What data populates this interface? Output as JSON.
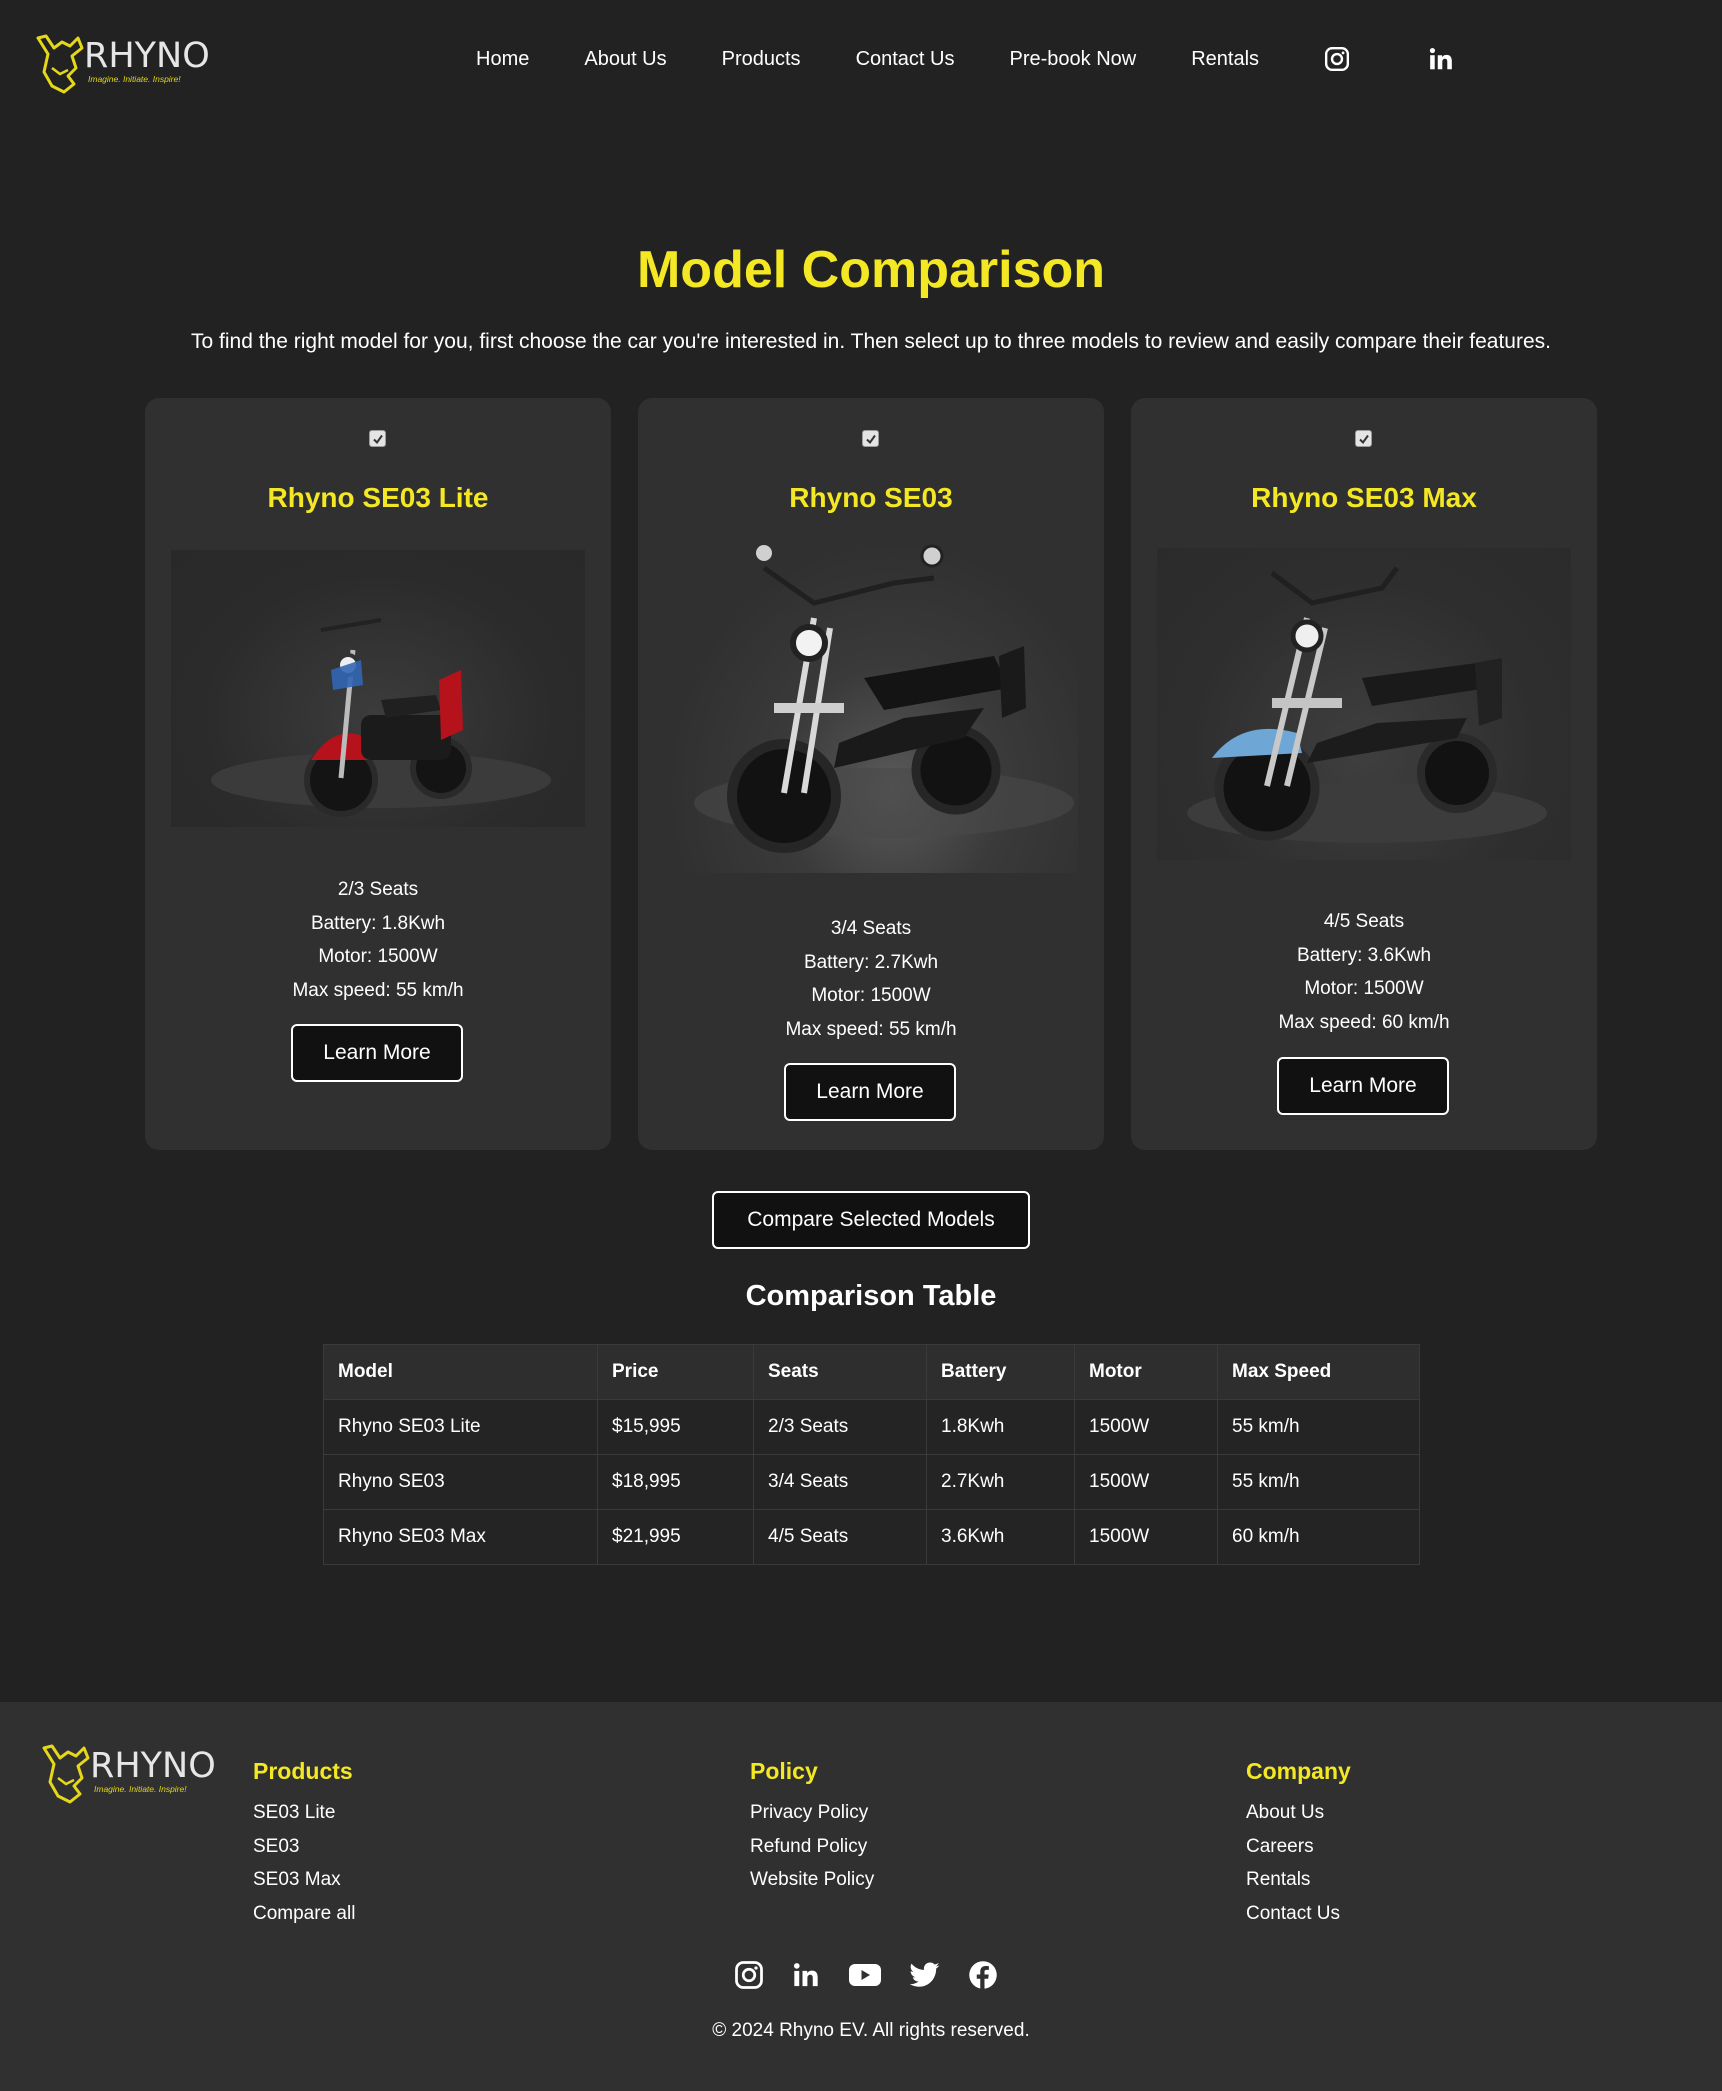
{
  "brand": {
    "name": "RHYNO",
    "tagline": "Imagine. Initiate. Inspire!"
  },
  "nav": {
    "items": [
      "Home",
      "About Us",
      "Products",
      "Contact Us",
      "Pre-book Now",
      "Rentals"
    ],
    "social": [
      "instagram-icon",
      "linkedin-icon"
    ]
  },
  "colors": {
    "accent": "#f4e824",
    "background": "#222222",
    "card": "#303030"
  },
  "hero": {
    "title": "Model Comparison",
    "intro": "To find the right model for you, first choose the car you're interested in. Then select up to three models to review and easily compare their features."
  },
  "cards": [
    {
      "name": "Rhyno SE03 Lite",
      "checked": true,
      "seats": "2/3 Seats",
      "battery": "Battery: 1.8Kwh",
      "motor": "Motor: 1500W",
      "speed": "Max speed: 55 km/h",
      "button": "Learn More"
    },
    {
      "name": "Rhyno SE03",
      "checked": true,
      "seats": "3/4 Seats",
      "battery": "Battery: 2.7Kwh",
      "motor": "Motor: 1500W",
      "speed": "Max speed: 55 km/h",
      "button": "Learn More"
    },
    {
      "name": "Rhyno SE03 Max",
      "checked": true,
      "seats": "4/5 Seats",
      "battery": "Battery: 3.6Kwh",
      "motor": "Motor: 1500W",
      "speed": "Max speed: 60 km/h",
      "button": "Learn More"
    }
  ],
  "compare_button": "Compare Selected Models",
  "table": {
    "title": "Comparison Table",
    "headers": [
      "Model",
      "Price",
      "Seats",
      "Battery",
      "Motor",
      "Max Speed"
    ],
    "rows": [
      [
        "Rhyno SE03 Lite",
        "$15,995",
        "2/3 Seats",
        "1.8Kwh",
        "1500W",
        "55 km/h"
      ],
      [
        "Rhyno SE03",
        "$18,995",
        "3/4 Seats",
        "2.7Kwh",
        "1500W",
        "55 km/h"
      ],
      [
        "Rhyno SE03 Max",
        "$21,995",
        "4/5 Seats",
        "3.6Kwh",
        "1500W",
        "60 km/h"
      ]
    ]
  },
  "footer": {
    "columns": [
      {
        "title": "Products",
        "links": [
          "SE03 Lite",
          "SE03",
          "SE03 Max",
          "Compare all"
        ]
      },
      {
        "title": "Policy",
        "links": [
          "Privacy Policy",
          "Refund Policy",
          "Website Policy"
        ]
      },
      {
        "title": "Company",
        "links": [
          "About Us",
          "Careers",
          "Rentals",
          "Contact Us"
        ]
      }
    ],
    "social": [
      "instagram-icon",
      "linkedin-icon",
      "youtube-icon",
      "twitter-icon",
      "facebook-icon"
    ],
    "copyright": "© 2024 Rhyno EV. All rights reserved."
  }
}
